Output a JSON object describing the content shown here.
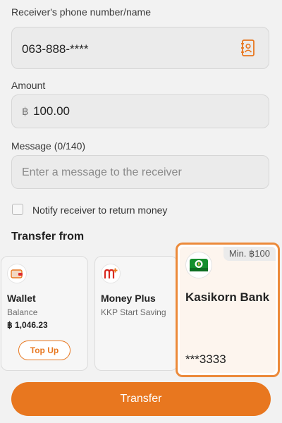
{
  "receiver": {
    "label": "Receiver's phone number/name",
    "value": "063-888-****"
  },
  "amount": {
    "label": "Amount",
    "currency": "฿",
    "value": "100.00"
  },
  "message": {
    "label": "Message (0/140)",
    "placeholder": "Enter a message to the receiver"
  },
  "notify": {
    "label": "Notify receiver to return money",
    "checked": false
  },
  "transfer_from": {
    "title": "Transfer from",
    "wallet": {
      "name": "Wallet",
      "sub": "Balance",
      "balance": "฿ 1,046.23",
      "topup_label": "Top Up"
    },
    "money_plus": {
      "name": "Money Plus",
      "sub": "KKP Start Saving"
    },
    "bank": {
      "min_label": "Min. ฿100",
      "name": "Kasikorn Bank",
      "account": "***3333",
      "selected": true
    }
  },
  "transfer_button": "Transfer",
  "colors": {
    "accent": "#e8771f",
    "selected_border": "#ec8a3a",
    "kasikorn_green": "#138f2d"
  }
}
